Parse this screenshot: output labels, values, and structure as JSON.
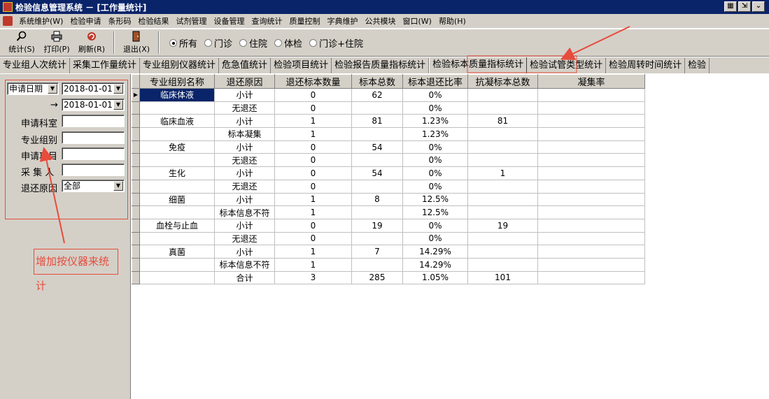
{
  "window": {
    "title": "检验信息管理系统 － [工作量统计]"
  },
  "menu": [
    "系统维护(W)",
    "检验申请",
    "条形码",
    "检验结果",
    "试剂管理",
    "设备管理",
    "查询统计",
    "质量控制",
    "字典维护",
    "公共模块",
    "窗口(W)",
    "帮助(H)"
  ],
  "toolbar": {
    "stat_label": "统计(S)",
    "print_label": "打印(P)",
    "refresh_label": "刷新(R)",
    "exit_label": "退出(X)",
    "radios": [
      {
        "label": "所有",
        "checked": true
      },
      {
        "label": "门诊",
        "checked": false
      },
      {
        "label": "住院",
        "checked": false
      },
      {
        "label": "体检",
        "checked": false
      },
      {
        "label": "门诊+住院",
        "checked": false
      }
    ]
  },
  "tabs": [
    "专业组人次统计",
    "采集工作量统计",
    "专业组别仪器统计",
    "危急值统计",
    "检验项目统计",
    "检验报告质量指标统计",
    "检验标本质量指标统计",
    "检验试管类型统计",
    "检验周转时间统计",
    "检验"
  ],
  "active_tab": 6,
  "filters": {
    "date_type": "申请日期",
    "date_from": "2018-01-01",
    "date_arrow": "→",
    "date_to": "2018-01-01",
    "labels": {
      "dept": "申请科室",
      "group": "专业组别",
      "item": "申请项目",
      "collector": "采 集 人",
      "reason": "退还原因"
    },
    "reason_value": "全部"
  },
  "annotation": {
    "text": "增加按仪器来统计"
  },
  "grid": {
    "columns": [
      "专业组别名称",
      "退还原因",
      "退还标本数量",
      "标本总数",
      "标本退还比率",
      "抗凝标本总数",
      "凝集率"
    ],
    "rows": [
      [
        "临床体液",
        "小计",
        "0",
        "62",
        "0%",
        "",
        ""
      ],
      [
        "",
        "无退还",
        "0",
        "",
        "0%",
        "",
        ""
      ],
      [
        "临床血液",
        "小计",
        "1",
        "81",
        "1.23%",
        "81",
        ""
      ],
      [
        "",
        "标本凝集",
        "1",
        "",
        "1.23%",
        "",
        ""
      ],
      [
        "免疫",
        "小计",
        "0",
        "54",
        "0%",
        "",
        ""
      ],
      [
        "",
        "无退还",
        "0",
        "",
        "0%",
        "",
        ""
      ],
      [
        "生化",
        "小计",
        "0",
        "54",
        "0%",
        "1",
        ""
      ],
      [
        "",
        "无退还",
        "0",
        "",
        "0%",
        "",
        ""
      ],
      [
        "细菌",
        "小计",
        "1",
        "8",
        "12.5%",
        "",
        ""
      ],
      [
        "",
        "标本信息不符",
        "1",
        "",
        "12.5%",
        "",
        ""
      ],
      [
        "血栓与止血",
        "小计",
        "0",
        "19",
        "0%",
        "19",
        ""
      ],
      [
        "",
        "无退还",
        "0",
        "",
        "0%",
        "",
        ""
      ],
      [
        "真菌",
        "小计",
        "1",
        "7",
        "14.29%",
        "",
        ""
      ],
      [
        "",
        "标本信息不符",
        "1",
        "",
        "14.29%",
        "",
        ""
      ],
      [
        "",
        "合计",
        "3",
        "285",
        "1.05%",
        "101",
        ""
      ]
    ]
  },
  "colors": {
    "titlebar": "#0a246a",
    "chrome": "#d4d0c8",
    "annotation": "#e74c3c"
  }
}
